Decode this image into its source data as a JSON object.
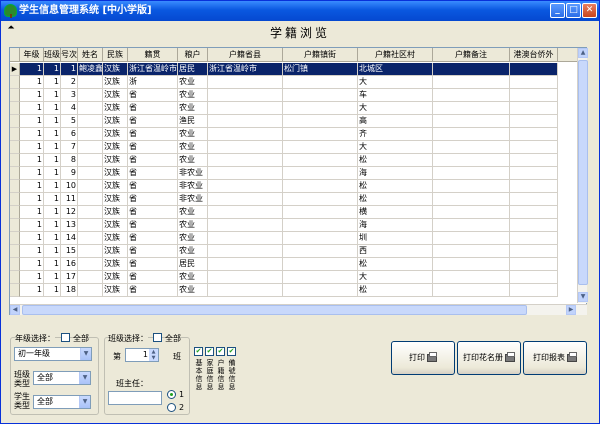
{
  "window": {
    "title": "学生信息管理系统 [中小学版]",
    "min": "_",
    "max": "□",
    "close": "✕"
  },
  "header": {
    "title": "学籍浏览",
    "icon": "⬛"
  },
  "grid": {
    "columns": [
      "年级",
      "班级",
      "号次",
      "姓名",
      "民族",
      "籍贯",
      "粮户",
      "户籍省县",
      "户籍镇街",
      "户籍社区村",
      "户籍备注",
      "港澳台侨外"
    ],
    "rows": [
      [
        "1",
        "1",
        "1",
        "鲍凌鑫",
        "汉族",
        "浙江省温岭市",
        "居民",
        "浙江省温岭市",
        "松门镇",
        "北城区",
        "",
        ""
      ],
      [
        "1",
        "1",
        "2",
        "",
        "汉族",
        "浙",
        "农业",
        "",
        "",
        "大",
        "",
        ""
      ],
      [
        "1",
        "1",
        "3",
        "",
        "汉族",
        "省",
        "农业",
        "",
        "",
        "车",
        "",
        ""
      ],
      [
        "1",
        "1",
        "4",
        "",
        "汉族",
        "省",
        "农业",
        "",
        "",
        "大",
        "",
        ""
      ],
      [
        "1",
        "1",
        "5",
        "",
        "汉族",
        "省",
        "渔民",
        "",
        "",
        "高",
        "",
        ""
      ],
      [
        "1",
        "1",
        "6",
        "",
        "汉族",
        "省",
        "农业",
        "",
        "",
        "齐",
        "",
        ""
      ],
      [
        "1",
        "1",
        "7",
        "",
        "汉族",
        "省",
        "农业",
        "",
        "",
        "大",
        "",
        ""
      ],
      [
        "1",
        "1",
        "8",
        "",
        "汉族",
        "省",
        "农业",
        "",
        "",
        "松",
        "",
        ""
      ],
      [
        "1",
        "1",
        "9",
        "",
        "汉族",
        "省",
        "非农业",
        "",
        "",
        "海",
        "",
        ""
      ],
      [
        "1",
        "1",
        "10",
        "",
        "汉族",
        "省",
        "非农业",
        "",
        "",
        "松",
        "",
        ""
      ],
      [
        "1",
        "1",
        "11",
        "",
        "汉族",
        "省",
        "非农业",
        "",
        "",
        "松",
        "",
        ""
      ],
      [
        "1",
        "1",
        "12",
        "",
        "汉族",
        "省",
        "农业",
        "",
        "",
        "横",
        "",
        ""
      ],
      [
        "1",
        "1",
        "13",
        "",
        "汉族",
        "省",
        "农业",
        "",
        "",
        "海",
        "",
        ""
      ],
      [
        "1",
        "1",
        "14",
        "",
        "汉族",
        "省",
        "农业",
        "",
        "",
        "圳",
        "",
        ""
      ],
      [
        "1",
        "1",
        "15",
        "",
        "汉族",
        "省",
        "农业",
        "",
        "",
        "西",
        "",
        ""
      ],
      [
        "1",
        "1",
        "16",
        "",
        "汉族",
        "省",
        "居民",
        "",
        "",
        "松",
        "",
        ""
      ],
      [
        "1",
        "1",
        "17",
        "",
        "汉族",
        "省",
        "农业",
        "",
        "",
        "大",
        "",
        ""
      ],
      [
        "1",
        "1",
        "18",
        "",
        "汉族",
        "省",
        "农业",
        "",
        "",
        "松",
        "",
        ""
      ]
    ]
  },
  "grade": {
    "label": "年级选择：",
    "all": "全部",
    "value": "初一年级"
  },
  "classType": {
    "label": "班级\n类型",
    "value": "全部"
  },
  "studentType": {
    "label": "学生\n类型",
    "value": "全部"
  },
  "classSel": {
    "label": "班级选择：",
    "all": "全部",
    "prefix": "第",
    "value": "1",
    "suffix": "班"
  },
  "teacher": {
    "label": "班主任：",
    "value": ""
  },
  "radios": [
    "1",
    "2"
  ],
  "infoChecks": [
    "基本信息",
    "家庭信息",
    "户籍信息",
    "備號信息"
  ],
  "buttons": {
    "print": "打印",
    "roster": "打印花名册",
    "report": "打印报表"
  }
}
